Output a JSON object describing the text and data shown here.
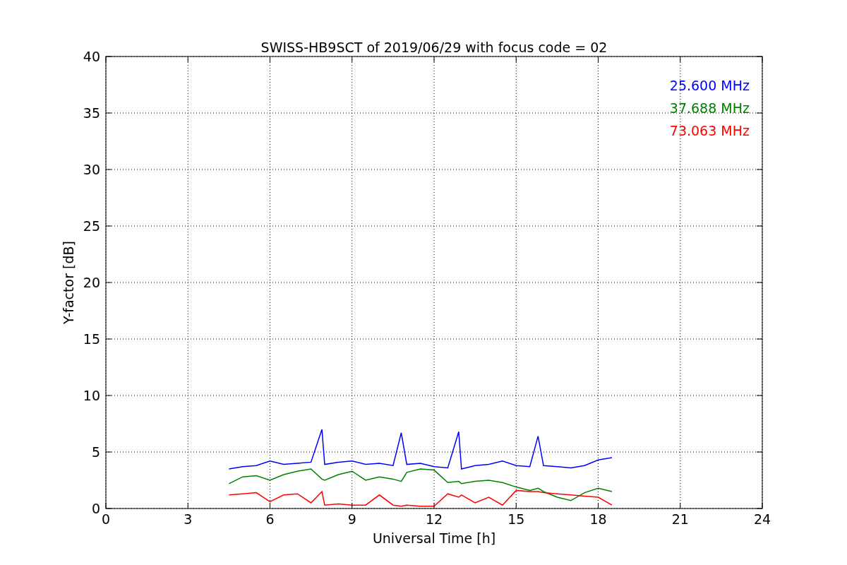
{
  "figure": {
    "chart_data": {
      "type": "line",
      "title": "SWISS-HB9SCT of 2019/06/29 with focus code = 02",
      "xlabel": "Universal Time [h]",
      "ylabel": "Y-factor [dB]",
      "x": [
        4.5,
        5,
        5.5,
        6,
        6.5,
        7,
        7.5,
        7.9,
        8,
        8.5,
        9,
        9.5,
        10,
        10.5,
        10.8,
        11,
        11.5,
        12,
        12.5,
        12.9,
        13,
        13.5,
        14,
        14.5,
        15,
        15.5,
        15.8,
        16,
        16.5,
        17,
        17.5,
        18,
        18.5
      ],
      "series": [
        {
          "name": "25.600 MHz",
          "color": "#0000ff",
          "values": [
            3.5,
            3.7,
            3.8,
            4.2,
            3.9,
            4.0,
            4.1,
            7.0,
            3.9,
            4.1,
            4.2,
            3.9,
            4.0,
            3.8,
            6.7,
            3.9,
            4.0,
            3.7,
            3.6,
            6.8,
            3.5,
            3.8,
            3.9,
            4.2,
            3.8,
            3.7,
            6.4,
            3.8,
            3.7,
            3.6,
            3.8,
            4.3,
            4.5
          ]
        },
        {
          "name": "37.688 MHz",
          "color": "#008000",
          "values": [
            2.2,
            2.8,
            2.9,
            2.5,
            3.0,
            3.3,
            3.5,
            2.6,
            2.5,
            3.0,
            3.3,
            2.5,
            2.8,
            2.6,
            2.4,
            3.2,
            3.5,
            3.4,
            2.3,
            2.4,
            2.2,
            2.4,
            2.5,
            2.3,
            1.9,
            1.6,
            1.8,
            1.5,
            1.0,
            0.7,
            1.4,
            1.8,
            1.5
          ]
        },
        {
          "name": "73.063 MHz",
          "color": "#ff0000",
          "values": [
            1.2,
            1.3,
            1.4,
            0.6,
            1.2,
            1.3,
            0.5,
            1.5,
            0.3,
            0.4,
            0.3,
            0.3,
            1.2,
            0.3,
            0.2,
            0.3,
            0.2,
            0.2,
            1.3,
            1.0,
            1.2,
            0.5,
            1.0,
            0.3,
            1.6,
            1.5,
            1.5,
            1.4,
            1.3,
            1.2,
            1.1,
            1.0,
            0.3
          ]
        }
      ],
      "xlim": [
        0,
        24
      ],
      "ylim": [
        0,
        40
      ],
      "xticks": [
        0,
        3,
        6,
        9,
        12,
        15,
        18,
        21,
        24
      ],
      "yticks": [
        0,
        5,
        10,
        15,
        20,
        25,
        30,
        35,
        40
      ],
      "grid": true
    }
  }
}
